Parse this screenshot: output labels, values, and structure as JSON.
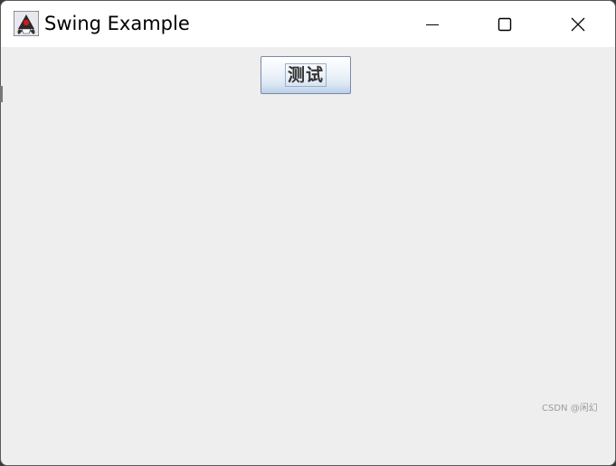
{
  "window": {
    "title": "Swing Example",
    "app_icon": "java-duke-icon",
    "controls": {
      "minimize_icon": "minimize-icon",
      "maximize_icon": "maximize-icon",
      "close_icon": "close-icon"
    }
  },
  "content": {
    "button_label": "测试",
    "background_color": "#eeeeee"
  },
  "watermark": "CSDN @闲幻",
  "colors": {
    "titlebar": "#ffffff",
    "button_border": "#7a8aa8",
    "button_gradient_bottom": "#b9cfe6",
    "text": "#000000"
  }
}
